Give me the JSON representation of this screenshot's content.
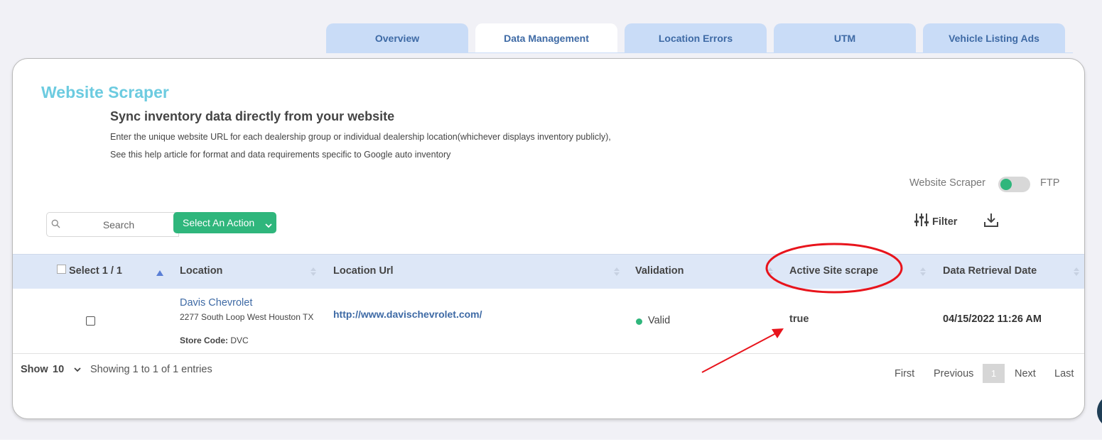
{
  "tabs": [
    {
      "label": "Overview",
      "active": false
    },
    {
      "label": "Data Management",
      "active": true
    },
    {
      "label": "Location Errors",
      "active": false
    },
    {
      "label": "UTM",
      "active": false
    },
    {
      "label": "Vehicle Listing Ads",
      "active": false
    }
  ],
  "header": {
    "title": "Website Scraper",
    "subtitle": "Sync inventory data directly from your website",
    "desc1": "Enter the unique website URL for each dealership group or individual dealership location(whichever displays inventory publicly),",
    "desc2": "See this help article for format and data requirements specific to Google auto inventory"
  },
  "toggle": {
    "left_label": "Website Scraper",
    "right_label": "FTP",
    "on": true,
    "color": "#2fb67c"
  },
  "toolbar": {
    "search_placeholder": "Search",
    "action_label": "Select An Action",
    "filter_label": "Filter"
  },
  "table": {
    "headers": {
      "select": "Select 1 / 1",
      "location": "Location",
      "location_url": "Location Url",
      "validation": "Validation",
      "active_site_scrape": "Active Site scrape",
      "data_retrieval_date": "Data Retrieval Date"
    },
    "rows": [
      {
        "location_name": "Davis Chevrolet",
        "address": "2277 South Loop West Houston TX",
        "store_code_label": "Store Code:",
        "store_code": "DVC",
        "url": "http://www.davischevrolet.com/",
        "validation": "Valid",
        "active": "true",
        "date": "04/15/2022 11:26 AM"
      }
    ]
  },
  "footer": {
    "show_label": "Show",
    "show_value": "10",
    "showing": "Showing 1 to 1 of 1 entries",
    "first": "First",
    "previous": "Previous",
    "current_page": "1",
    "next": "Next",
    "last": "Last"
  },
  "colors": {
    "accent_green": "#2fb67c",
    "title_blue": "#6ccbe0",
    "link_blue": "#3e6aa5",
    "tab_bg": "#c9dcf7",
    "annotation_red": "#e8141c"
  }
}
